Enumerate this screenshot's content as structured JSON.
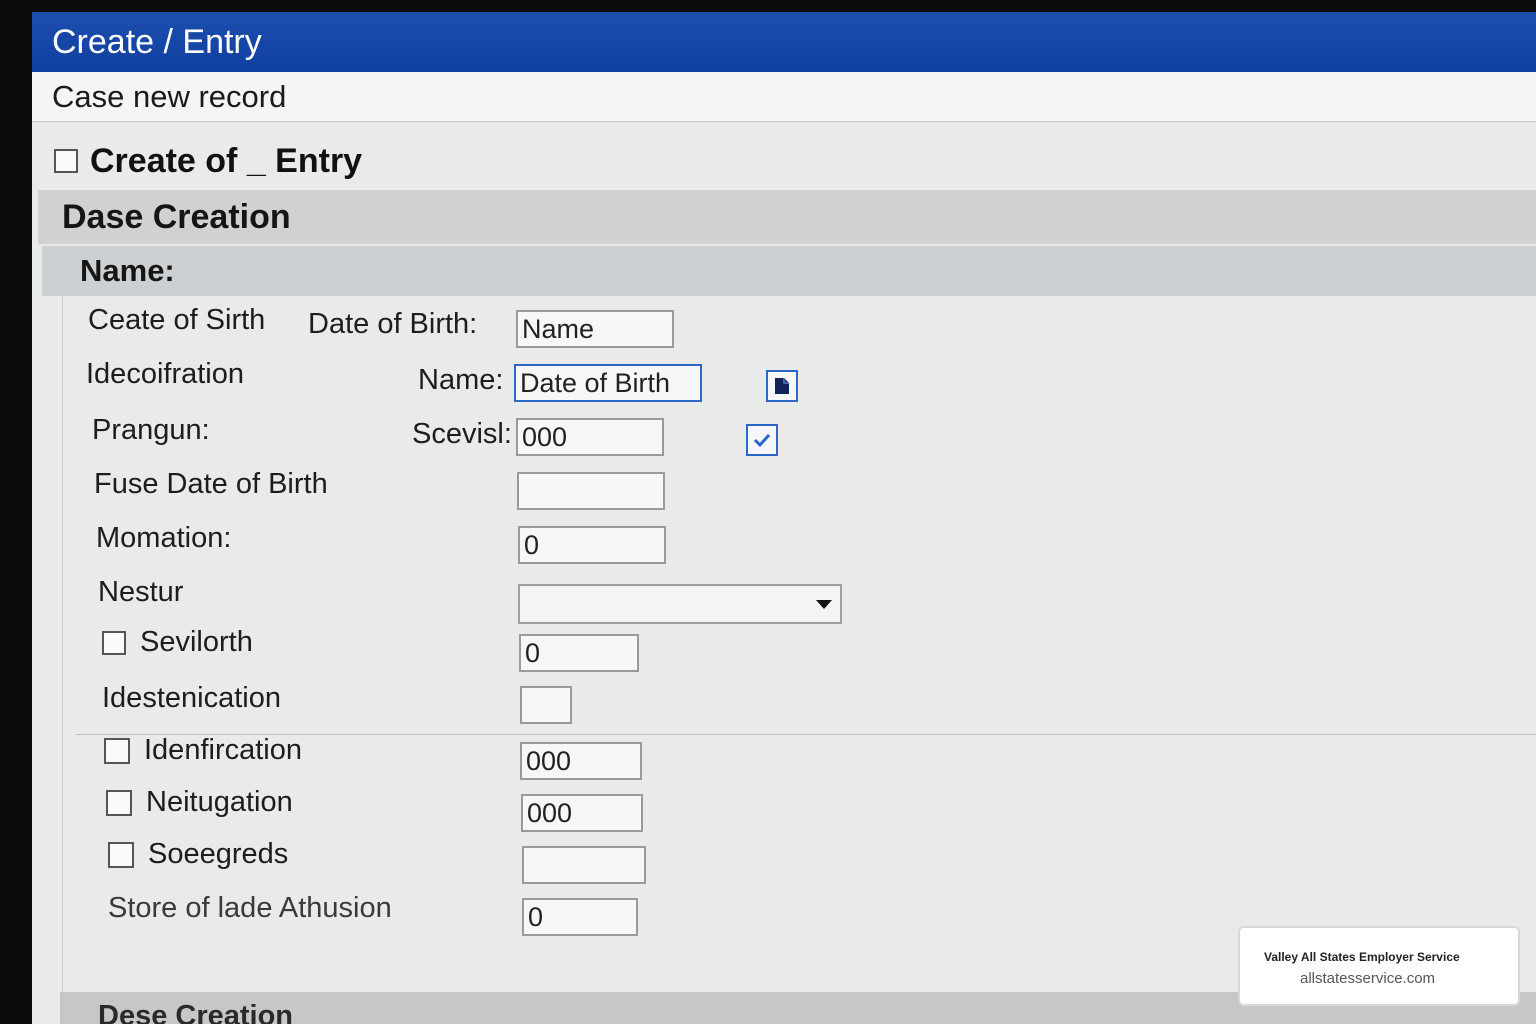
{
  "window": {
    "title": "Create / Entry",
    "subtitle": "Case new record"
  },
  "heading": {
    "label": "Create of _ Entry"
  },
  "sections": {
    "primary": "Dase Creation",
    "name_band": "Name:",
    "footer": "Dese Creation"
  },
  "fields": {
    "ceate_of_sirth": {
      "label": "Ceate of Sirth",
      "inline_label": "Date of Birth:",
      "value": "Name"
    },
    "idecoifration": {
      "label": "Idecoifration",
      "inline_label": "Name:",
      "value": "Date of Birth"
    },
    "prangun": {
      "label": "Prangun:",
      "inline_label": "Scevisl:",
      "value": "000",
      "checked": true
    },
    "fuse_date_of_birth": {
      "label": "Fuse Date of Birth",
      "value": ""
    },
    "momation": {
      "label": "Momation:",
      "value": "0"
    },
    "nestur": {
      "label": "Nestur",
      "selected": ""
    },
    "sevilorth": {
      "label": "Sevilorth",
      "value": "0"
    },
    "idestenication": {
      "label": "Idestenication",
      "value": ""
    },
    "idenfircation": {
      "label": "Idenfircation",
      "value": "000"
    },
    "neitugation": {
      "label": "Neitugation",
      "value": "000"
    },
    "soeegreds": {
      "label": "Soeegreds",
      "value": ""
    },
    "store_of_lade": {
      "label": "Store of lade Athusion",
      "value": "0"
    }
  },
  "icons": {
    "attach": "document-icon",
    "check": "checkmark-icon",
    "dropdown": "chevron-down-icon"
  },
  "colors": {
    "titlebar": "#1d4fb0",
    "accent": "#2b67c7"
  },
  "brand": {
    "name": "Valley All States Employer Service",
    "url": "allstatesservice.com"
  }
}
